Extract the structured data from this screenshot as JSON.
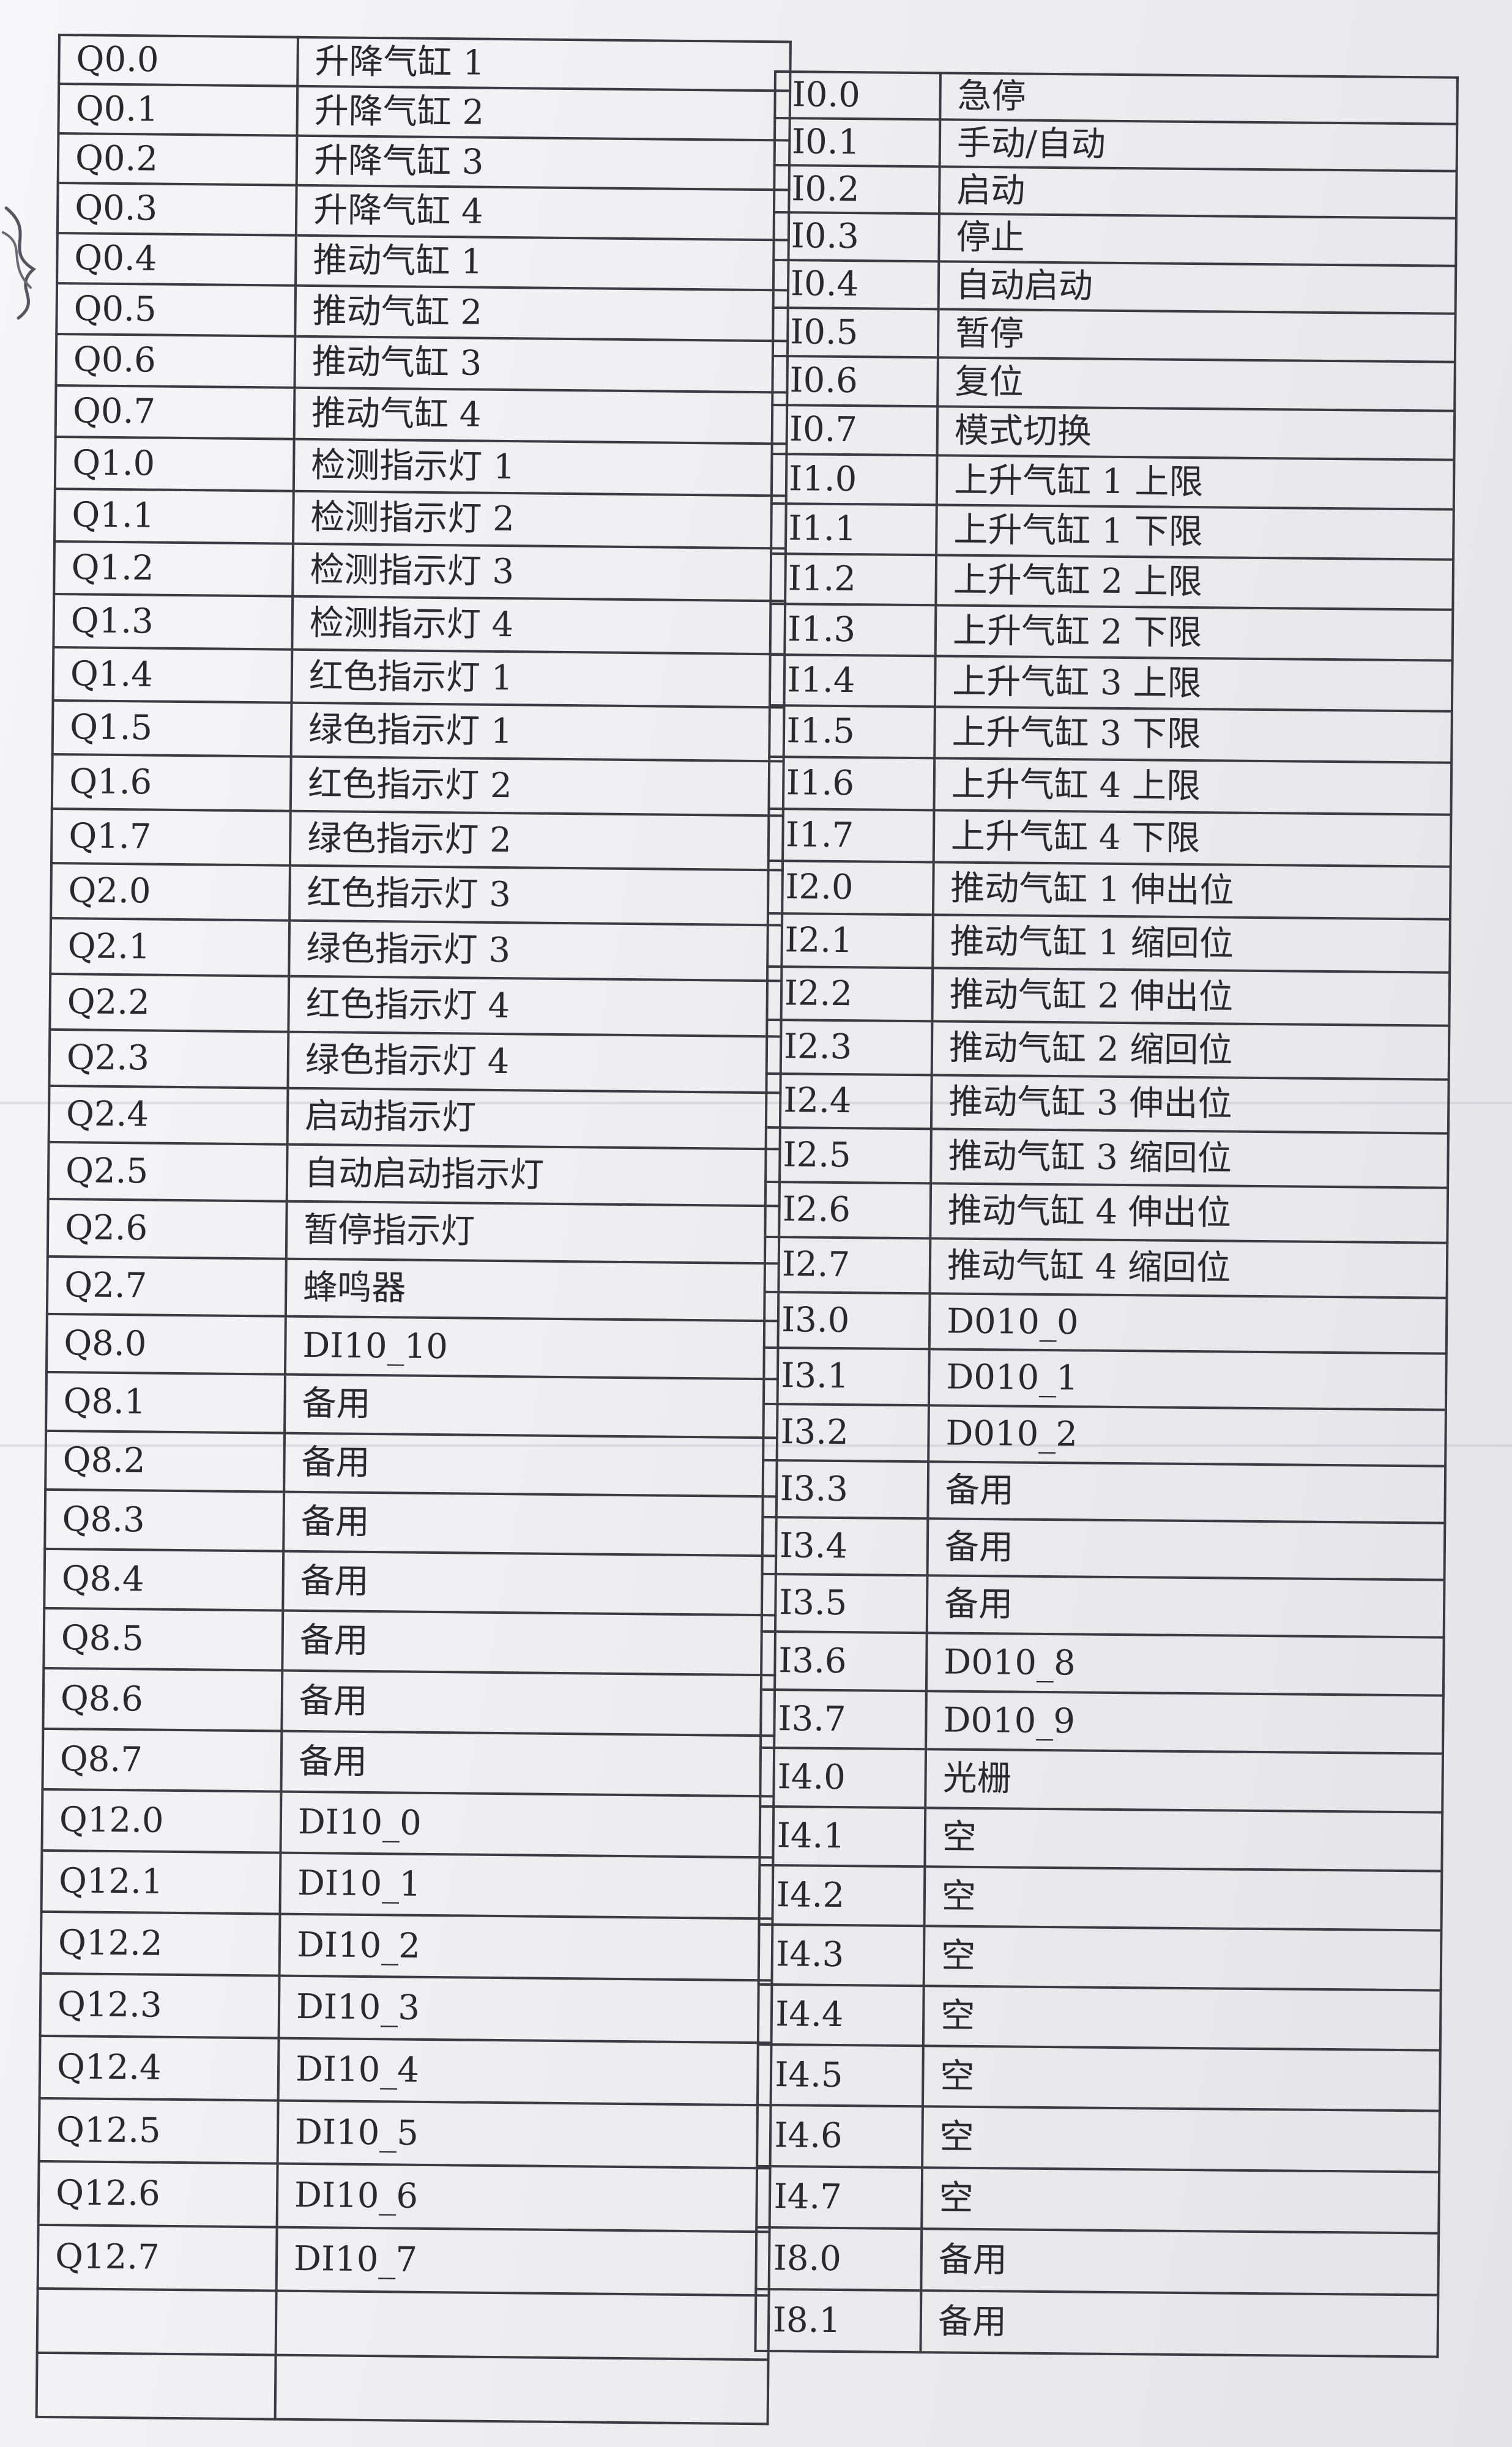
{
  "left_table": {
    "rows": [
      {
        "addr": "Q0.0",
        "desc": "升降气缸 1"
      },
      {
        "addr": "Q0.1",
        "desc": "升降气缸 2"
      },
      {
        "addr": "Q0.2",
        "desc": "升降气缸 3"
      },
      {
        "addr": "Q0.3",
        "desc": "升降气缸 4"
      },
      {
        "addr": "Q0.4",
        "desc": "推动气缸 1"
      },
      {
        "addr": "Q0.5",
        "desc": "推动气缸 2"
      },
      {
        "addr": "Q0.6",
        "desc": "推动气缸 3"
      },
      {
        "addr": "Q0.7",
        "desc": "推动气缸 4"
      },
      {
        "addr": "Q1.0",
        "desc": "检测指示灯 1"
      },
      {
        "addr": "Q1.1",
        "desc": "检测指示灯 2"
      },
      {
        "addr": "Q1.2",
        "desc": "检测指示灯 3"
      },
      {
        "addr": "Q1.3",
        "desc": "检测指示灯 4"
      },
      {
        "addr": "Q1.4",
        "desc": "红色指示灯 1"
      },
      {
        "addr": "Q1.5",
        "desc": "绿色指示灯 1"
      },
      {
        "addr": "Q1.6",
        "desc": "红色指示灯 2"
      },
      {
        "addr": "Q1.7",
        "desc": "绿色指示灯 2"
      },
      {
        "addr": "Q2.0",
        "desc": "红色指示灯 3"
      },
      {
        "addr": "Q2.1",
        "desc": "绿色指示灯 3"
      },
      {
        "addr": "Q2.2",
        "desc": "红色指示灯 4"
      },
      {
        "addr": "Q2.3",
        "desc": "绿色指示灯 4"
      },
      {
        "addr": "Q2.4",
        "desc": "启动指示灯"
      },
      {
        "addr": "Q2.5",
        "desc": "自动启动指示灯"
      },
      {
        "addr": "Q2.6",
        "desc": "暂停指示灯"
      },
      {
        "addr": "Q2.7",
        "desc": "蜂鸣器"
      },
      {
        "addr": "Q8.0",
        "desc": "DI10_10"
      },
      {
        "addr": "Q8.1",
        "desc": "备用"
      },
      {
        "addr": "Q8.2",
        "desc": "备用"
      },
      {
        "addr": "Q8.3",
        "desc": "备用"
      },
      {
        "addr": "Q8.4",
        "desc": "备用"
      },
      {
        "addr": "Q8.5",
        "desc": "备用"
      },
      {
        "addr": "Q8.6",
        "desc": "备用"
      },
      {
        "addr": "Q8.7",
        "desc": "备用"
      },
      {
        "addr": "Q12.0",
        "desc": "DI10_0"
      },
      {
        "addr": "Q12.1",
        "desc": "DI10_1"
      },
      {
        "addr": "Q12.2",
        "desc": "DI10_2"
      },
      {
        "addr": "Q12.3",
        "desc": "DI10_3"
      },
      {
        "addr": "Q12.4",
        "desc": "DI10_4"
      },
      {
        "addr": "Q12.5",
        "desc": "DI10_5"
      },
      {
        "addr": "Q12.6",
        "desc": "DI10_6"
      },
      {
        "addr": "Q12.7",
        "desc": "DI10_7"
      },
      {
        "addr": "",
        "desc": ""
      },
      {
        "addr": "",
        "desc": ""
      }
    ]
  },
  "right_table": {
    "rows": [
      {
        "addr": "I0.0",
        "desc": "急停"
      },
      {
        "addr": "I0.1",
        "desc": "手动/自动"
      },
      {
        "addr": "I0.2",
        "desc": "启动"
      },
      {
        "addr": "I0.3",
        "desc": "停止"
      },
      {
        "addr": "I0.4",
        "desc": "自动启动"
      },
      {
        "addr": "I0.5",
        "desc": "暂停"
      },
      {
        "addr": "I0.6",
        "desc": "复位"
      },
      {
        "addr": "I0.7",
        "desc": "模式切换"
      },
      {
        "addr": "I1.0",
        "desc": "上升气缸 1 上限"
      },
      {
        "addr": "I1.1",
        "desc": "上升气缸 1 下限"
      },
      {
        "addr": "I1.2",
        "desc": "上升气缸 2 上限"
      },
      {
        "addr": "I1.3",
        "desc": "上升气缸 2 下限"
      },
      {
        "addr": "I1.4",
        "desc": "上升气缸 3 上限"
      },
      {
        "addr": "I1.5",
        "desc": "上升气缸 3 下限"
      },
      {
        "addr": "I1.6",
        "desc": "上升气缸 4 上限"
      },
      {
        "addr": "I1.7",
        "desc": "上升气缸 4 下限"
      },
      {
        "addr": "I2.0",
        "desc": "推动气缸 1 伸出位"
      },
      {
        "addr": "I2.1",
        "desc": "推动气缸 1 缩回位"
      },
      {
        "addr": "I2.2",
        "desc": "推动气缸 2 伸出位"
      },
      {
        "addr": "I2.3",
        "desc": "推动气缸 2 缩回位"
      },
      {
        "addr": "I2.4",
        "desc": "推动气缸 3 伸出位"
      },
      {
        "addr": "I2.5",
        "desc": "推动气缸 3 缩回位"
      },
      {
        "addr": "I2.6",
        "desc": "推动气缸 4 伸出位"
      },
      {
        "addr": "I2.7",
        "desc": "推动气缸 4 缩回位"
      },
      {
        "addr": "I3.0",
        "desc": "D010_0"
      },
      {
        "addr": "I3.1",
        "desc": "D010_1"
      },
      {
        "addr": "I3.2",
        "desc": "D010_2"
      },
      {
        "addr": "I3.3",
        "desc": "备用"
      },
      {
        "addr": "I3.4",
        "desc": "备用"
      },
      {
        "addr": "I3.5",
        "desc": "备用"
      },
      {
        "addr": "I3.6",
        "desc": "D010_8"
      },
      {
        "addr": "I3.7",
        "desc": "D010_9"
      },
      {
        "addr": "I4.0",
        "desc": "光栅"
      },
      {
        "addr": "I4.1",
        "desc": "空"
      },
      {
        "addr": "I4.2",
        "desc": "空"
      },
      {
        "addr": "I4.3",
        "desc": "空"
      },
      {
        "addr": "I4.4",
        "desc": "空"
      },
      {
        "addr": "I4.5",
        "desc": "空"
      },
      {
        "addr": "I4.6",
        "desc": "空"
      },
      {
        "addr": "I4.7",
        "desc": "空"
      },
      {
        "addr": "I8.0",
        "desc": "备用"
      },
      {
        "addr": "I8.1",
        "desc": "备用"
      }
    ]
  }
}
